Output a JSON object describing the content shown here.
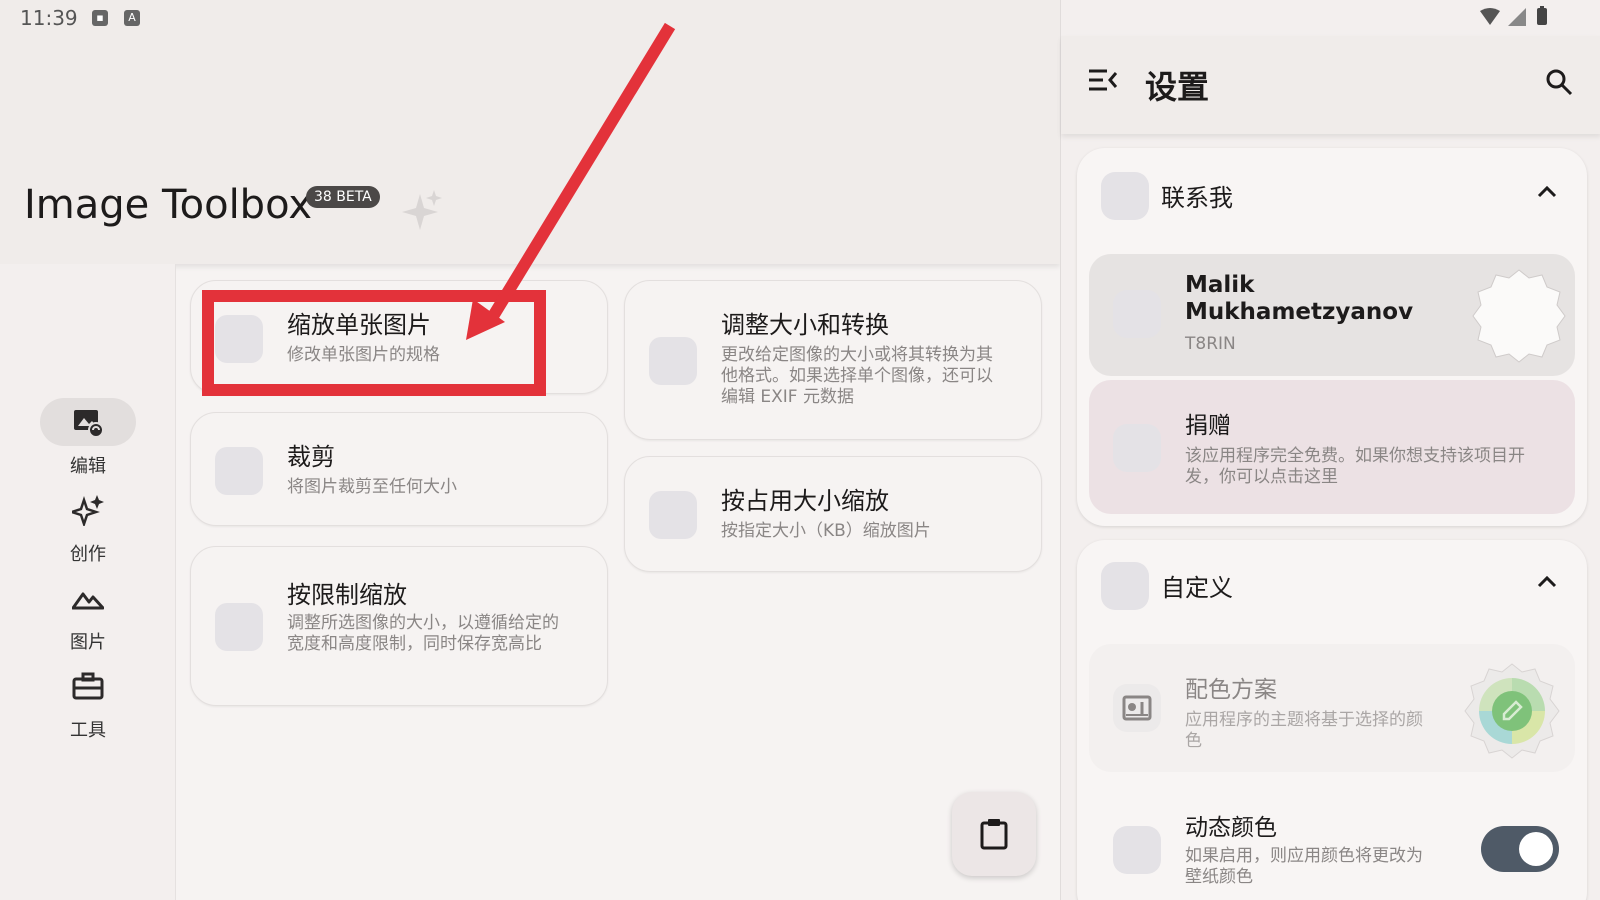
{
  "status_bar": {
    "time": "11:39"
  },
  "header": {
    "app_name": "Image Toolbox",
    "badge": "38 BETA"
  },
  "nav": {
    "items": [
      {
        "label": "编辑",
        "icon": "edit-image-icon",
        "active": true
      },
      {
        "label": "创作",
        "icon": "sparkles-icon",
        "active": false
      },
      {
        "label": "图片",
        "icon": "landscape-icon",
        "active": false
      },
      {
        "label": "工具",
        "icon": "toolbox-icon",
        "active": false
      }
    ]
  },
  "tools": [
    {
      "title": "缩放单张图片",
      "desc": "修改单张图片的规格"
    },
    {
      "title": "裁剪",
      "desc": "将图片裁剪至任何大小"
    },
    {
      "title": "按限制缩放",
      "desc": "调整所选图像的大小，以遵循给定的宽度和高度限制，同时保存宽高比"
    },
    {
      "title": "调整大小和转换",
      "desc": "更改给定图像的大小或将其转换为其他格式。如果选择单个图像，还可以编辑 EXIF 元数据"
    },
    {
      "title": "按占用大小缩放",
      "desc": "按指定大小（KB）缩放图片"
    }
  ],
  "settings": {
    "title": "设置",
    "contact_section": {
      "title": "联系我",
      "author_name": "Malik Mukhametzyanov",
      "author_handle": "T8RIN",
      "donate_title": "捐赠",
      "donate_desc": "该应用程序完全免费。如果你想支持该项目开发，你可以点击这里"
    },
    "customize_section": {
      "title": "自定义",
      "color_scheme_title": "配色方案",
      "color_scheme_desc": "应用程序的主题将基于选择的颜色",
      "dynamic_color_title": "动态颜色",
      "dynamic_color_desc": "如果启用，则应用颜色将更改为壁纸颜色",
      "dynamic_color_enabled": true
    }
  },
  "colors": {
    "annotation_red": "#e3323a",
    "toggle_track": "#4f5a67",
    "donate_bg": "#ece1e4"
  }
}
